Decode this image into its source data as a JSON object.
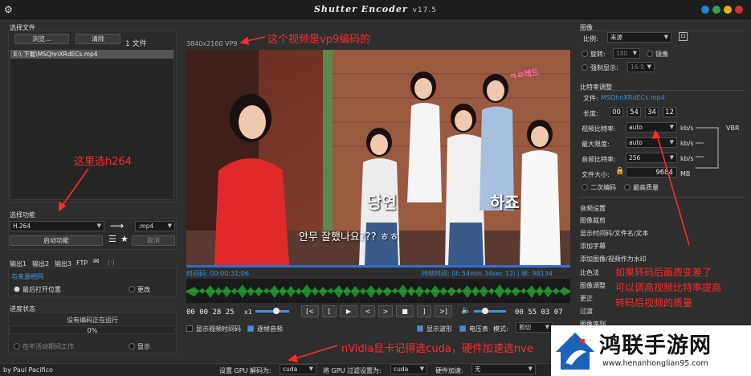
{
  "app": {
    "title": "Shutter Encoder",
    "version": "v17.5",
    "credit": "by Paul Pacifico"
  },
  "left": {
    "select_files_title": "选择文件",
    "browse_button": "浏览...",
    "clear_button": "清除",
    "file_count": "1 文件",
    "file_item": "E:\\ 下载\\MSQhnXRdECs.mp4",
    "choose_function_title": "选择功能",
    "function_value": "H.264",
    "container_value": ".mp4",
    "start_button": "启动功能",
    "cancel_button": "取消",
    "output_tabs": [
      "输出1",
      "输出2",
      "输出3",
      "FTP"
    ],
    "same_as_source": "与来源相同",
    "open_last_location": "最后打开位置",
    "change_button": "更改",
    "progress_title": "进度状态",
    "no_encoding": "没有编码正在运行",
    "progress_value": "0%",
    "work_when_idle": "在不活动期间工作",
    "display_label": "显示"
  },
  "center": {
    "resolution_label": "3840x2160 VP9",
    "caption1": "당연",
    "caption2": "하죠",
    "caption3": "안무 잘했나요??? ㅎㅎ",
    "tv_logo": "ㅋㄹ레드",
    "timecode_label": "时间码: 00:00:31;06",
    "duration_label": "持续时间: 0h 54min 34sec 12i | 帧: 98134",
    "tc_in": "00 00 28 25",
    "speed": "x1",
    "tc_out": "00 55 03 07",
    "transport": [
      "[<",
      "[",
      "▶",
      "<",
      ">",
      "■",
      "]",
      ">]"
    ],
    "show_timecode": "显示视频时间码",
    "frame_audio": "逐帧音频",
    "show_waveform": "显示波形",
    "vu_meter": "电压表",
    "mode_label": "模式:",
    "mode_value": "剪切"
  },
  "right": {
    "image_title": "图像",
    "ratio_label": "比例:",
    "ratio_value": "来源",
    "rotate_label": "旋转:",
    "rotate_value": "180",
    "mirror_label": "镜像",
    "force_display_label": "强制显示:",
    "force_display_value": "16:9",
    "bitrate_title": "比特率调整",
    "file_label": "文件:",
    "file_value": "MSQhnXRdECs.mp4",
    "length_label": "长度:",
    "length_values": [
      "00",
      "54",
      "34",
      "12"
    ],
    "video_bitrate_label": "视频比特率:",
    "video_bitrate_value": "auto",
    "max_limit_label": "最大限度:",
    "max_limit_value": "auto",
    "audio_bitrate_label": "音频比特率:",
    "audio_bitrate_value": "256",
    "file_size_label": "文件大小:",
    "file_size_value": "9684",
    "unit_kbs": "kb/s",
    "unit_mb": "MB",
    "vbr": "VBR",
    "two_pass": "二次编码",
    "max_quality": "最高质量",
    "sections": [
      "音频设置",
      "图像裁剪",
      "显示时间码/文件名/文本",
      "添加字幕",
      "添加图像/视频作为水印",
      "比色法",
      "图像调整",
      "更正",
      "过渡",
      "图像序列"
    ]
  },
  "bottom": {
    "gpu_decode_label": "设置 GPU 解码为:",
    "gpu_decode_value": "cuda",
    "gpu_filter_label": "将 GPU 过滤设置为:",
    "gpu_filter_value": "cuda",
    "hw_accel_label": "硬件加速:",
    "hw_accel_value": "无"
  },
  "annotations": {
    "vp9": "这个视频是vp9编码的",
    "h264": "这里选h264",
    "quality1": "如果转码后画质变差了",
    "quality2": "可以调高视频比特率提高",
    "quality3": "转码后视频的质量",
    "nvidia": "nVidia显卡记得选cuda，硬件加速选nve"
  },
  "watermark": {
    "brand": "鸿联手游网",
    "url": "www.henanhonglian95.com"
  },
  "colors": {
    "accent": "#3f8fe0",
    "annotation": "#ff2a2a",
    "waveform": "#1f8a2a",
    "video_bar": "#2e6fd0"
  }
}
